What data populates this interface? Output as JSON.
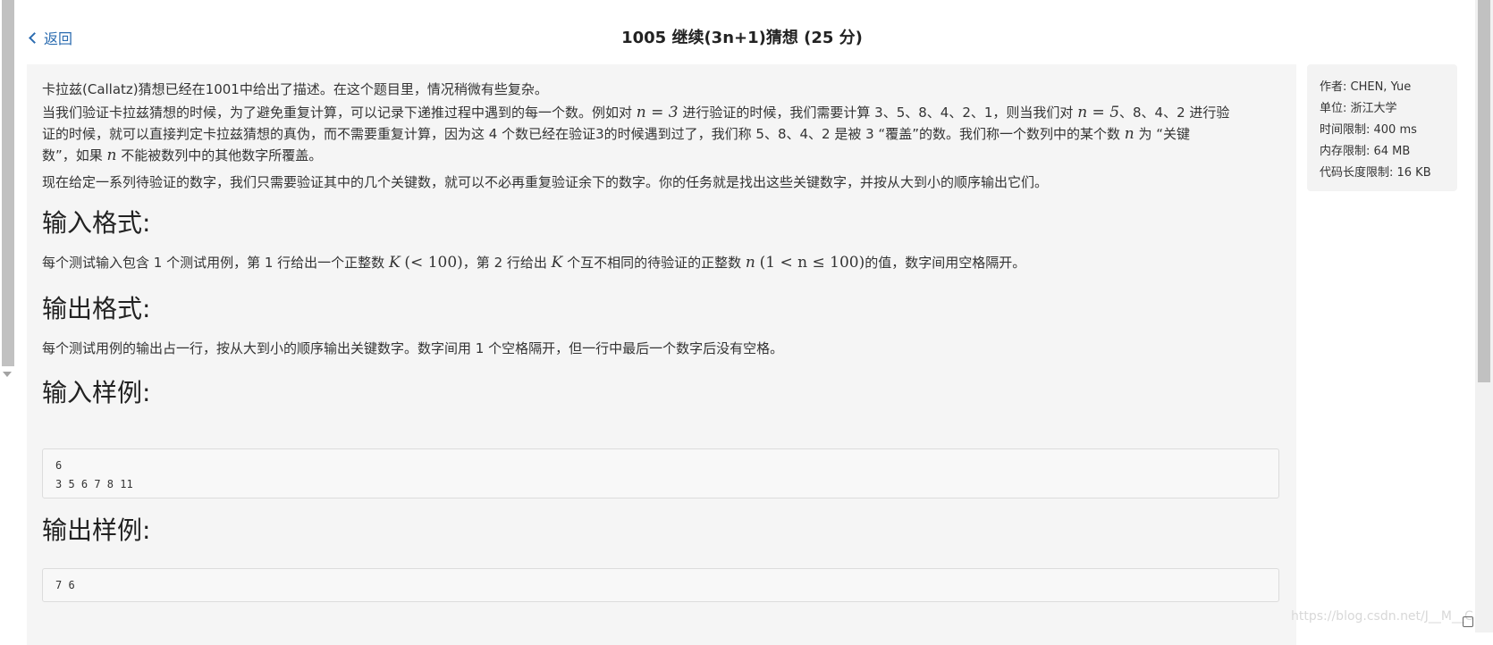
{
  "header": {
    "back_label": "返回",
    "title": "1005 继续(3n+1)猜想 (25 分)"
  },
  "problem": {
    "p1": "卡拉兹(Callatz)猜想已经在1001中给出了描述。在这个题目里，情况稍微有些复杂。",
    "p2": {
      "t1": "当我们验证卡拉兹猜想的时候，为了避免重复计算，可以记录下递推过程中遇到的每一个数。例如对 ",
      "m1": "n = 3",
      "t2": " 进行验证的时候，我们需要计算 3、5、8、4、2、1，则当我们对 ",
      "m2": "n = 5",
      "t3": "、8、4、2 进行验",
      "t4": "证的时候，就可以直接判定卡拉兹猜想的真伪，而不需要重复计算，因为这 4 个数已经在验证3的时候遇到过了，我们称 5、8、4、2 是被 3 “覆盖”的数。我们称一个数列中的某个数 ",
      "m3": "n",
      "t5": " 为 “关键",
      "t6": "数”，如果 ",
      "m4": "n",
      "t7": " 不能被数列中的其他数字所覆盖。"
    },
    "p3": "现在给定一系列待验证的数字，我们只需要验证其中的几个关键数，就可以不必再重复验证余下的数字。你的任务就是找出这些关键数字，并按从大到小的顺序输出它们。",
    "input_heading": "输入格式:",
    "input_desc": {
      "t1": "每个测试输入包含 1 个测试用例，第 1 行给出一个正整数 ",
      "m1": "K",
      "m2": "(< 100)",
      "t2": "，第 2 行给出 ",
      "m3": "K",
      "t3": " 个互不相同的待验证的正整数 ",
      "m4": "n",
      "m5": "(1 < n ≤ 100)",
      "t4": "的值，数字间用空格隔开。"
    },
    "output_heading": "输出格式:",
    "output_desc": "每个测试用例的输出占一行，按从大到小的顺序输出关键数字。数字间用 1 个空格隔开，但一行中最后一个数字后没有空格。",
    "sample_input_heading": "输入样例:",
    "sample_input": "6\n3 5 6 7 8 11",
    "sample_output_heading": "输出样例:",
    "sample_output": "7 6"
  },
  "info": {
    "author": "作者: CHEN, Yue",
    "unit": "单位: 浙江大学",
    "time_limit": "时间限制: 400 ms",
    "memory_limit": "内存限制: 64 MB",
    "code_limit": "代码长度限制: 16 KB"
  },
  "watermark": "https://blog.csdn.net/J__M__C"
}
